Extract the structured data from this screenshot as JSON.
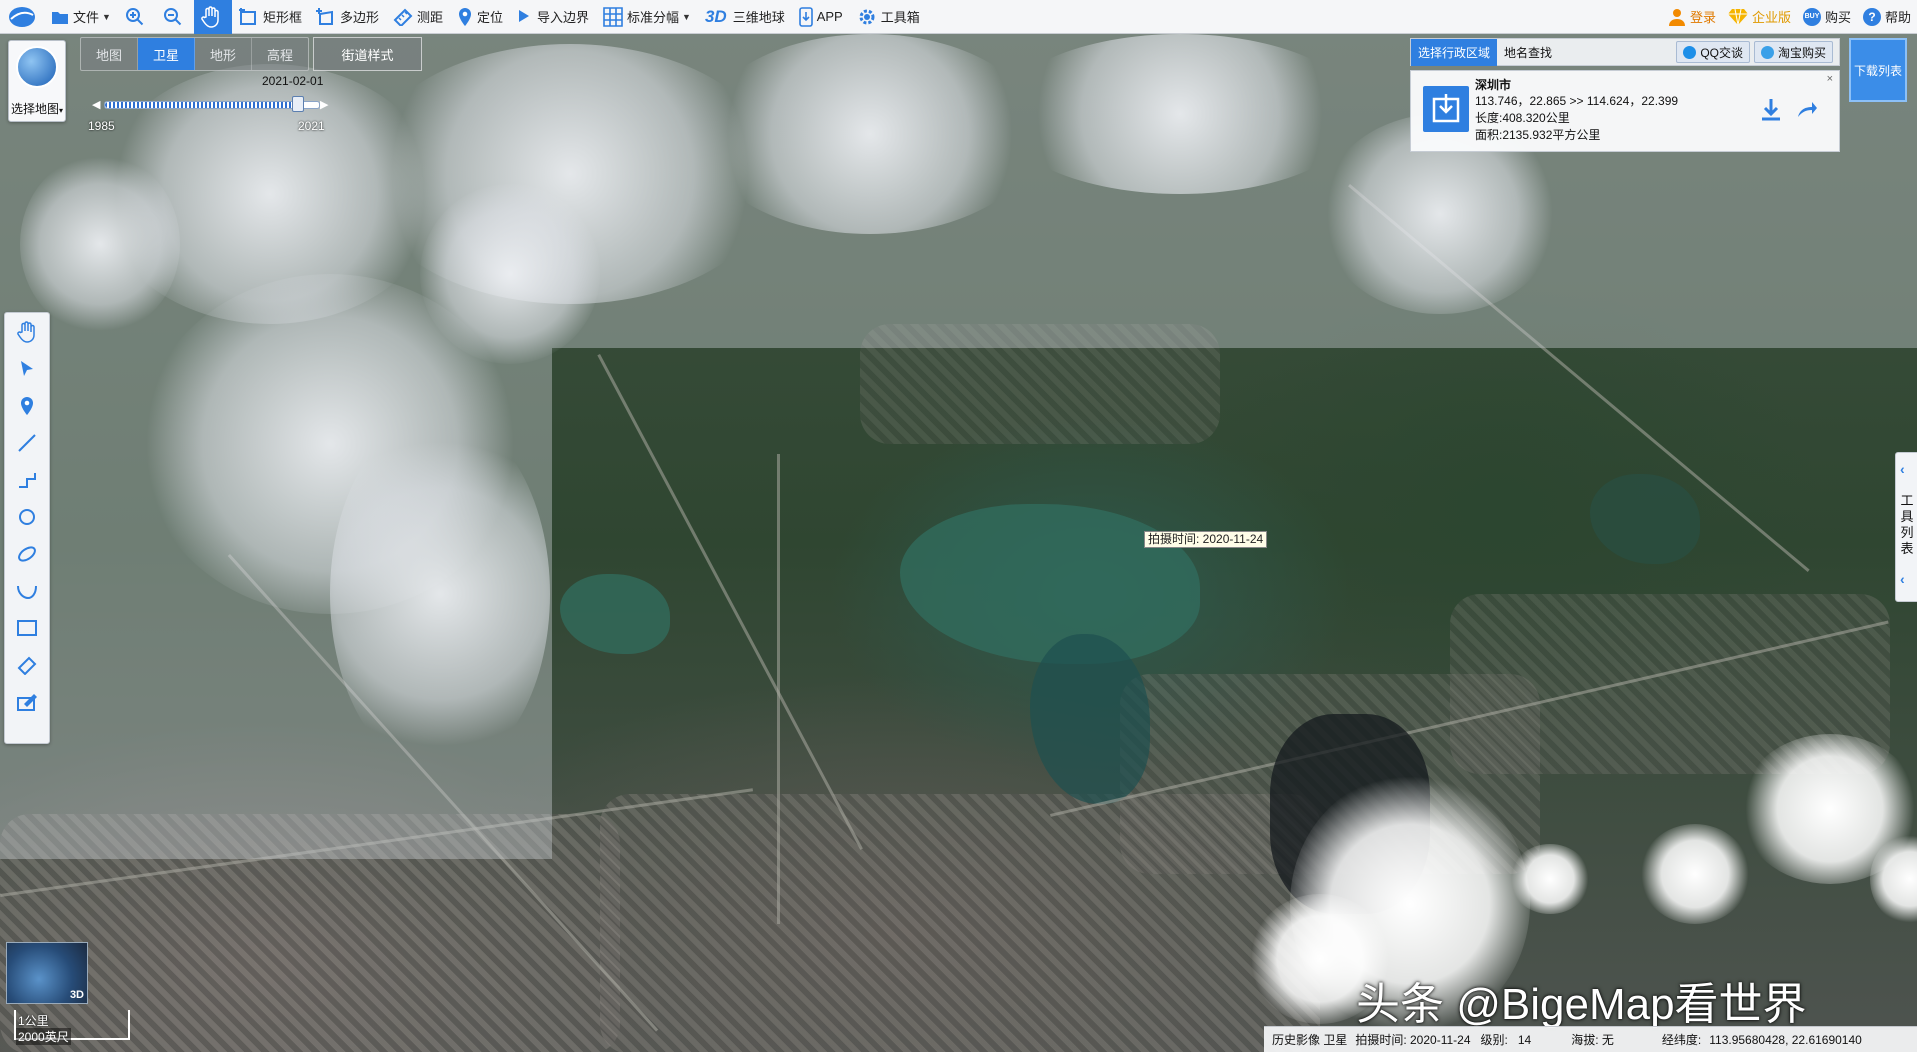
{
  "toolbar": {
    "file": "文件",
    "rect_frame": "矩形框",
    "polygon": "多边形",
    "measure": "测距",
    "locate": "定位",
    "import_border": "导入边界",
    "std_tiles": "标准分幅",
    "three_d_label": "3D",
    "globe_3d": "三维地球",
    "app": "APP",
    "toolbox": "工具箱",
    "login": "登录",
    "enterprise": "企业版",
    "buy_badge": "BUY",
    "buy": "购买",
    "help": "帮助",
    "colors": {
      "accent": "#2f7fe0",
      "enterprise": "#e89a00",
      "login": "#f28a00"
    }
  },
  "map_selector": {
    "label": "选择地图"
  },
  "mode_tabs": [
    "地图",
    "卫星",
    "地形",
    "高程"
  ],
  "mode_active": "卫星",
  "street_style": "街道样式",
  "timeline": {
    "current": "2021-02-01",
    "min": "1985",
    "max": "2021",
    "progress": 0.9
  },
  "draw_tools": [
    "hand-icon",
    "pointer-icon",
    "pin-icon",
    "line-icon",
    "polyline-icon",
    "circle-icon",
    "ellipse-icon",
    "curve-icon",
    "rectangle-icon",
    "ruler-icon",
    "area-measure-icon"
  ],
  "region_panel": {
    "tab_admin": "选择行政区域",
    "tab_search": "地名查找",
    "qq": "QQ交谈",
    "taobao": "淘宝购买",
    "city": "深圳市",
    "coords": "113.746，22.865 >> 114.624，22.399",
    "length": "长度:408.320公里",
    "area": "面积:2135.932平方公里",
    "close": "×"
  },
  "download_list": "下载列表",
  "tool_list": {
    "text": "工具列表",
    "chev": "‹"
  },
  "capture_label": "拍摄时间: 2020-11-24",
  "mini_globe": {
    "badge": "3D"
  },
  "scale": {
    "top": "1公里",
    "bottom": "2000英尺"
  },
  "watermark": "头条 @BigeMap看世界",
  "status": {
    "source": "历史影像 卫星",
    "capture_time": "拍摄时间: 2020-11-24",
    "level_label": "级别:",
    "level": "14",
    "altitude": "海拔: 无",
    "lonlat_label": "经纬度:",
    "lonlat": "113.95680428, 22.61690140"
  }
}
